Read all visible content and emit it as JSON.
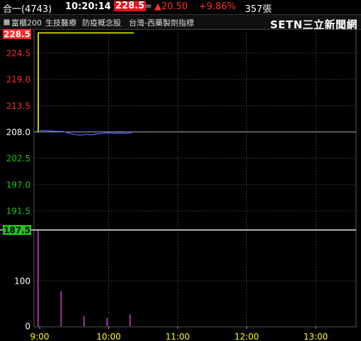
{
  "header": {
    "stock_name": "合一(4743)",
    "time": "10:20:14",
    "price": "228.5",
    "equals_sign": "=",
    "change": "▲20.50",
    "change_pct": "+9.86%",
    "volume": "357張"
  },
  "subheader": {
    "items": [
      "富櫃200",
      "生技醫療",
      "防疫概念股",
      "台灣-西藥製劑指標"
    ],
    "logo": "SETN三立新聞網"
  },
  "colors": {
    "up": "#ff2a2a",
    "down": "#19c819",
    "price_line": "#5060ff",
    "volume_bar": "#c83cc8",
    "limit_line": "#ffff00",
    "ref_line": "#ffffff"
  },
  "chart_data": {
    "type": "line",
    "price_ticks": [
      "228.5",
      "224.5",
      "219.0",
      "213.5",
      "208.0",
      "202.5",
      "197.0",
      "191.5",
      "187.5"
    ],
    "ylim": [
      187.5,
      228.5
    ],
    "reference_price": 208.0,
    "limit_up": 228.5,
    "limit_down": 187.5,
    "volume_ticks": [
      "100",
      "0"
    ],
    "volume_ylim": [
      0,
      100
    ],
    "x_ticks": [
      "9:00",
      "10:00",
      "11:00",
      "12:00",
      "13:00"
    ],
    "series": [
      {
        "x": [
          "9:00",
          "9:05",
          "9:10",
          "9:15",
          "9:20",
          "9:25",
          "9:30",
          "9:35",
          "9:40",
          "9:45",
          "9:50",
          "9:55",
          "10:00",
          "10:05",
          "10:10",
          "10:15",
          "10:20"
        ],
        "values": [
          208.3,
          208.3,
          208.2,
          208.1,
          208.1,
          207.8,
          207.5,
          207.3,
          207.5,
          207.4,
          207.6,
          207.7,
          207.8,
          207.7,
          207.8,
          207.7,
          207.8
        ]
      }
    ],
    "limit_up_trace": {
      "x": [
        "9:00",
        "10:20"
      ],
      "values": [
        228.5,
        228.5
      ]
    },
    "volume": {
      "x": [
        "9:00",
        "9:20",
        "9:40",
        "10:00",
        "10:20"
      ],
      "values": [
        225,
        77,
        22,
        18,
        26
      ]
    }
  }
}
